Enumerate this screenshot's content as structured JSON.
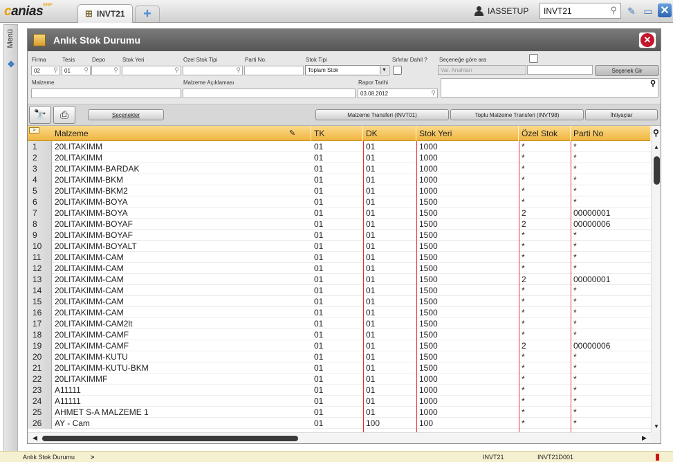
{
  "app": {
    "logo": "canias",
    "logo_sup": "ERP",
    "tab_label": "INVT21",
    "user": "IASSETUP",
    "search_value": "INVT21"
  },
  "window": {
    "title": "Anlık Stok Durumu"
  },
  "filters": {
    "firma_label": "Firma",
    "firma_value": "02",
    "tesis_label": "Tesis",
    "tesis_value": "01",
    "depo_label": "Depo",
    "depo_value": "",
    "stok_yeri_label": "Stok Yeri",
    "stok_yeri_value": "",
    "ozel_stok_tipi_label": "Özel Stok Tipi",
    "ozel_stok_tipi_value": "",
    "parti_no_label": "Parti No.",
    "parti_no_value": "",
    "stok_tipi_label": "Stok Tipi",
    "stok_tipi_value": "Toplam Stok",
    "sifirlar_label": "Sıfırlar Dahil ?",
    "secenege_label": "Seçeneğe göre ara",
    "var_anahtari_placeholder": "Var. Anahtarı",
    "secenek_gir_label": "Seçenek Gir",
    "malzeme_label": "Malzeme",
    "malzeme_value": "",
    "malzeme_aciklamasi_label": "Malzeme Açıklaması",
    "malzeme_aciklamasi_value": "",
    "rapor_tarihi_label": "Rapor Tarihi",
    "rapor_tarihi_value": "03.08.2012"
  },
  "toolbar": {
    "secenekler_label": "Seçenekler",
    "malzeme_transferi_label": "Malzeme Transferi (INVT01)",
    "toplu_transfer_label": "Toplu Malzeme Transferi (INVT98)",
    "ihtiyaclar_label": "İhtiyaçlar"
  },
  "grid": {
    "corner": ">",
    "columns": [
      "Malzeme",
      "TK",
      "DK",
      "Stok Yeri",
      "Özel Stok",
      "Parti No"
    ],
    "rows": [
      [
        "1",
        "20LITAKIMM",
        "01",
        "01",
        "1000",
        "*",
        "*"
      ],
      [
        "2",
        "20LITAKIMM",
        "01",
        "01",
        "1000",
        "*",
        "*"
      ],
      [
        "3",
        "20LITAKIMM-BARDAK",
        "01",
        "01",
        "1000",
        "*",
        "*"
      ],
      [
        "4",
        "20LITAKIMM-BKM",
        "01",
        "01",
        "1000",
        "*",
        "*"
      ],
      [
        "5",
        "20LITAKIMM-BKM2",
        "01",
        "01",
        "1000",
        "*",
        "*"
      ],
      [
        "6",
        "20LITAKIMM-BOYA",
        "01",
        "01",
        "1500",
        "*",
        "*"
      ],
      [
        "7",
        "20LITAKIMM-BOYA",
        "01",
        "01",
        "1500",
        "2",
        "00000001"
      ],
      [
        "8",
        "20LITAKIMM-BOYAF",
        "01",
        "01",
        "1500",
        "2",
        "00000006"
      ],
      [
        "9",
        "20LITAKIMM-BOYAF",
        "01",
        "01",
        "1500",
        "*",
        "*"
      ],
      [
        "10",
        "20LITAKIMM-BOYALT",
        "01",
        "01",
        "1500",
        "*",
        "*"
      ],
      [
        "11",
        "20LITAKIMM-CAM",
        "01",
        "01",
        "1500",
        "*",
        "*"
      ],
      [
        "12",
        "20LITAKIMM-CAM",
        "01",
        "01",
        "1500",
        "*",
        "*"
      ],
      [
        "13",
        "20LITAKIMM-CAM",
        "01",
        "01",
        "1500",
        "2",
        "00000001"
      ],
      [
        "14",
        "20LITAKIMM-CAM",
        "01",
        "01",
        "1500",
        "*",
        "*"
      ],
      [
        "15",
        "20LITAKIMM-CAM",
        "01",
        "01",
        "1500",
        "*",
        "*"
      ],
      [
        "16",
        "20LITAKIMM-CAM",
        "01",
        "01",
        "1500",
        "*",
        "*"
      ],
      [
        "17",
        "20LITAKIMM-CAM2lt",
        "01",
        "01",
        "1500",
        "*",
        "*"
      ],
      [
        "18",
        "20LITAKIMM-CAMF",
        "01",
        "01",
        "1500",
        "*",
        "*"
      ],
      [
        "19",
        "20LITAKIMM-CAMF",
        "01",
        "01",
        "1500",
        "2",
        "00000006"
      ],
      [
        "20",
        "20LITAKIMM-KUTU",
        "01",
        "01",
        "1500",
        "*",
        "*"
      ],
      [
        "21",
        "20LITAKIMM-KUTU-BKM",
        "01",
        "01",
        "1500",
        "*",
        "*"
      ],
      [
        "22",
        "20LITAKIMMF",
        "01",
        "01",
        "1000",
        "*",
        "*"
      ],
      [
        "23",
        "A11111",
        "01",
        "01",
        "1000",
        "*",
        "*"
      ],
      [
        "24",
        "A11111",
        "01",
        "01",
        "1000",
        "*",
        "*"
      ],
      [
        "25",
        "AHMET S-A MALZEME 1",
        "01",
        "01",
        "1000",
        "*",
        "*"
      ],
      [
        "26",
        "AY - Cam",
        "01",
        "100",
        "100",
        "*",
        "*"
      ]
    ]
  },
  "side": {
    "menu_label": "Menü"
  },
  "status": {
    "text": "Anlık Stok Durumu",
    "arrow": ">",
    "code1": "INVT21",
    "code2": "INVT21D001"
  }
}
